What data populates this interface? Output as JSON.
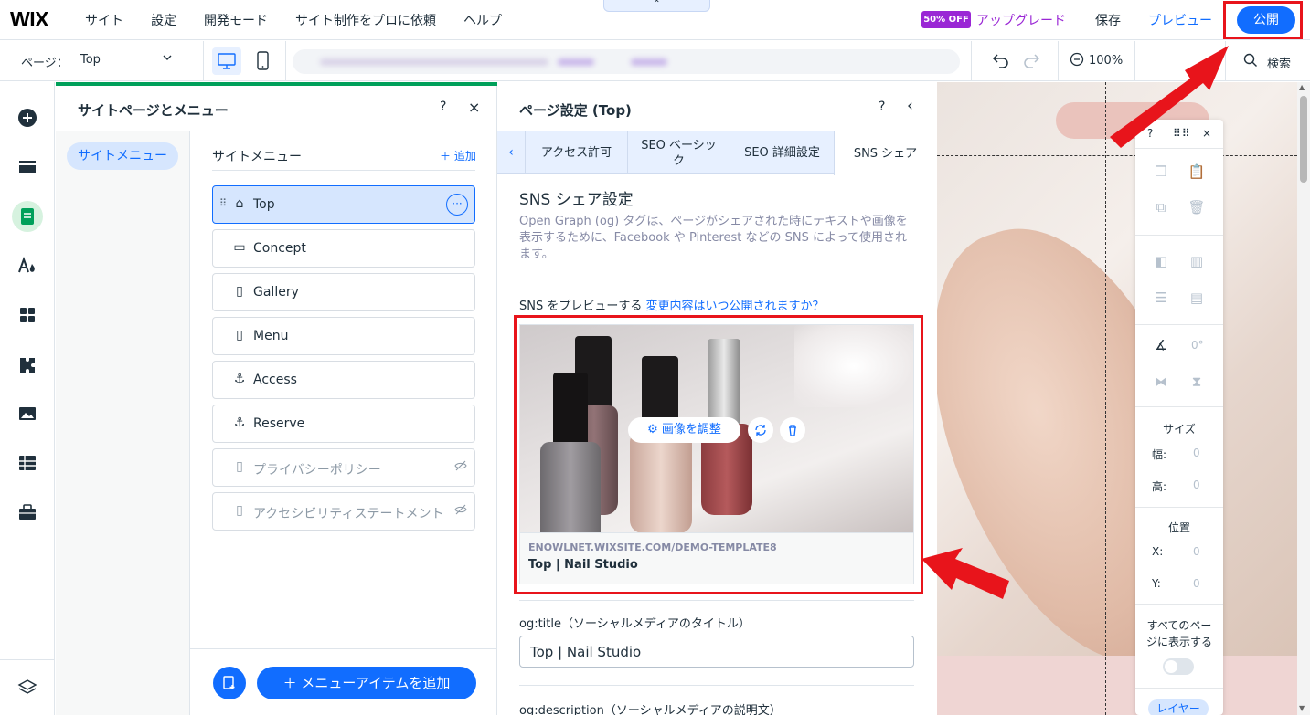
{
  "topbar": {
    "logo": "WIX",
    "menu": [
      "サイト",
      "設定",
      "開発モード",
      "サイト制作をプロに依頼",
      "ヘルプ"
    ],
    "collapse_glyph": "⌃",
    "sale_badge": "50% OFF",
    "upgrade": "アップグレード",
    "save": "保存",
    "preview": "プレビュー",
    "publish": "公開"
  },
  "toolbar2": {
    "page_label": "ページ：",
    "page_value": "Top",
    "zoom": "100%",
    "search": "検索"
  },
  "rail": {
    "items": [
      "add-icon",
      "sections-icon",
      "pages-icon",
      "design-icon",
      "apps-icon",
      "puzzle-icon",
      "media-icon",
      "cms-icon",
      "business-icon",
      "layers-icon"
    ]
  },
  "pages_panel": {
    "title": "サイトページとメニュー",
    "help": "?",
    "close": "×",
    "side_pill": "サイトメニュー",
    "list_title": "サイトメニュー",
    "add": "＋ 追加",
    "items": [
      {
        "label": "Top",
        "icon": "home-icon",
        "glyph": "⌂"
      },
      {
        "label": "Concept",
        "icon": "section-page-icon",
        "glyph": "▭"
      },
      {
        "label": "Gallery",
        "icon": "page-icon",
        "glyph": "▯"
      },
      {
        "label": "Menu",
        "icon": "page-icon",
        "glyph": "▯"
      },
      {
        "label": "Access",
        "icon": "anchor-icon",
        "glyph": "⚓"
      },
      {
        "label": "Reserve",
        "icon": "anchor-icon",
        "glyph": "⚓"
      },
      {
        "label": "プライバシーポリシー",
        "icon": "page-icon",
        "glyph": "▯"
      },
      {
        "label": "アクセシビリティステートメント",
        "icon": "page-icon",
        "glyph": "▯"
      }
    ],
    "add_menu_item": "＋ メニューアイテムを追加"
  },
  "settings": {
    "title": "ページ設定 (Top)",
    "help": "?",
    "back": "‹",
    "tabs": [
      "アクセス許可",
      "SEO ベーシック",
      "SEO 詳細設定",
      "SNS シェア"
    ],
    "heading": "SNS シェア設定",
    "description": "Open Graph (og) タグは、ページがシェアされた時にテキストや画像を表示するために、Facebook や Pinterest などの SNS によって使用されます。",
    "preview_label": "SNS をプレビューする",
    "preview_link": "変更内容はいつ公開されますか？",
    "adjust_image": "画像を調整",
    "card_url": "ENOWLNET.WIXSITE.COM/DEMO-TEMPLATE8",
    "card_title": "Top | Nail Studio",
    "og_title_label": "og:title（ソーシャルメディアのタイトル）",
    "og_title_value": "Top | Nail Studio",
    "og_desc_label": "og:description（ソーシャルメディアの説明文）"
  },
  "float_toolbar": {
    "help": "?",
    "close": "×",
    "rotation": "0°",
    "size_heading": "サイズ",
    "width_label": "幅:",
    "width_value": "0",
    "height_label": "高:",
    "height_value": "0",
    "position_heading": "位置",
    "x_label": "X:",
    "x_value": "0",
    "y_label": "Y:",
    "y_value": "0",
    "show_all_pages": "すべてのページに表示する",
    "layers": "レイヤー"
  },
  "colors": {
    "accent": "#116dff",
    "annotation_red": "#e8141b",
    "premium": "#9a27d5",
    "panel_top": "#00a05a"
  }
}
